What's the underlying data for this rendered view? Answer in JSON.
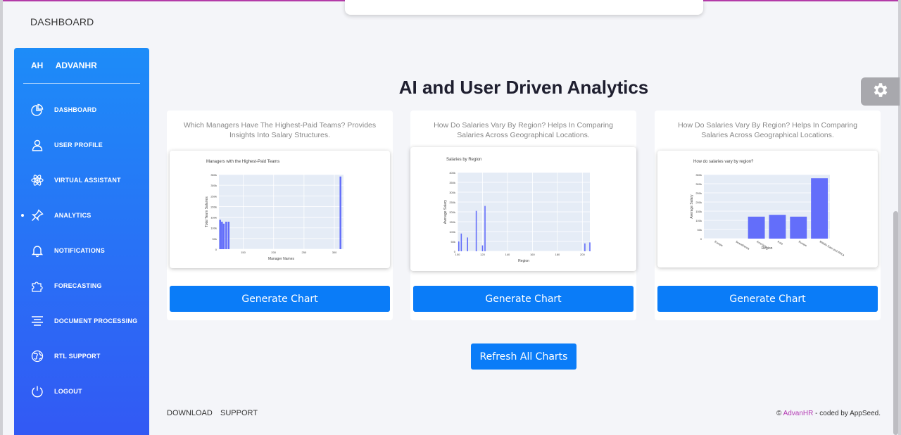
{
  "topbar": {
    "title": "DASHBOARD"
  },
  "sidebar": {
    "brand_short": "AH",
    "brand_name": "ADVANHR",
    "items": [
      {
        "label": "DASHBOARD",
        "icon": "pie-chart-icon"
      },
      {
        "label": "USER PROFILE",
        "icon": "user-icon"
      },
      {
        "label": "VIRTUAL ASSISTANT",
        "icon": "atom-icon"
      },
      {
        "label": "ANALYTICS",
        "icon": "pin-icon",
        "active": true
      },
      {
        "label": "NOTIFICATIONS",
        "icon": "bell-icon"
      },
      {
        "label": "FORECASTING",
        "icon": "puzzle-icon"
      },
      {
        "label": "DOCUMENT PROCESSING",
        "icon": "align-center-icon"
      },
      {
        "label": "RTL SUPPORT",
        "icon": "globe-icon"
      },
      {
        "label": "LOGOUT",
        "icon": "power-icon"
      }
    ]
  },
  "main": {
    "title": "AI and User Driven Analytics",
    "refresh_label": "Refresh All Charts",
    "cards": [
      {
        "description": "Which Managers Have The Highest-Paid Teams? Provides Insights Into Salary Structures.",
        "button_label": "Generate Chart"
      },
      {
        "description": "How Do Salaries Vary By Region? Helps In Comparing Salaries Across Geographical Locations.",
        "button_label": "Generate Chart"
      },
      {
        "description": "How Do Salaries Vary By Region? Helps In Comparing Salaries Across Geographical Locations.",
        "button_label": "Generate Chart"
      }
    ]
  },
  "footer": {
    "links": [
      "DOWNLOAD",
      "SUPPORT"
    ],
    "copyright_symbol": "©",
    "copyright_brand": "AdvanHR",
    "copyright_suffix": " - coded by AppSeed."
  },
  "colors": {
    "sidebar_top": "#1d8cf8",
    "sidebar_bottom": "#3358f4",
    "button": "#0a7cf8",
    "bar": "#636efa",
    "plot_bg": "#e5ecf6"
  },
  "chart_data": [
    {
      "type": "bar",
      "title": "Managers with the Highest-Paid Teams",
      "xlabel": "Manager Names",
      "ylabel": "Total Team Salaries",
      "x": [
        112,
        115,
        118,
        122,
        126,
        310
      ],
      "values": [
        150000,
        140000,
        130000,
        140000,
        140000,
        370000
      ],
      "xlim": [
        110,
        315
      ],
      "ylim": [
        0,
        380000
      ],
      "xticks": [
        "150",
        "200",
        "250",
        "300"
      ],
      "yticks": [
        "0",
        "50k",
        "100k",
        "150k",
        "200k",
        "250k",
        "300k",
        "350k"
      ],
      "grid": true
    },
    {
      "type": "bar",
      "title": "Salaries by Region",
      "xlabel": "Region",
      "ylabel": "Average Salary",
      "x": [
        101,
        103,
        108,
        115,
        120,
        122,
        202,
        206
      ],
      "values": [
        50000,
        90000,
        70000,
        205000,
        30000,
        230000,
        40000,
        45000
      ],
      "xlim": [
        100,
        206
      ],
      "ylim": [
        0,
        400000
      ],
      "xticks": [
        "100",
        "120",
        "140",
        "160",
        "180",
        "200"
      ],
      "yticks": [
        "0",
        "50k",
        "100k",
        "150k",
        "200k",
        "250k",
        "300k",
        "350k",
        "400k"
      ],
      "grid": true
    },
    {
      "type": "bar",
      "title": "How do salaries vary by region?",
      "xlabel": "Region",
      "ylabel": "Average Salary",
      "categories": [
        "Europe",
        "Scandinavia",
        "Americas",
        "Asia",
        "Europe",
        "Middle East and Africa"
      ],
      "values": [
        0,
        0,
        120000,
        130000,
        120000,
        330000
      ],
      "ylim": [
        0,
        350000
      ],
      "yticks": [
        "0",
        "50k",
        "100k",
        "150k",
        "200k",
        "250k",
        "300k",
        "350k"
      ],
      "grid": true
    }
  ]
}
